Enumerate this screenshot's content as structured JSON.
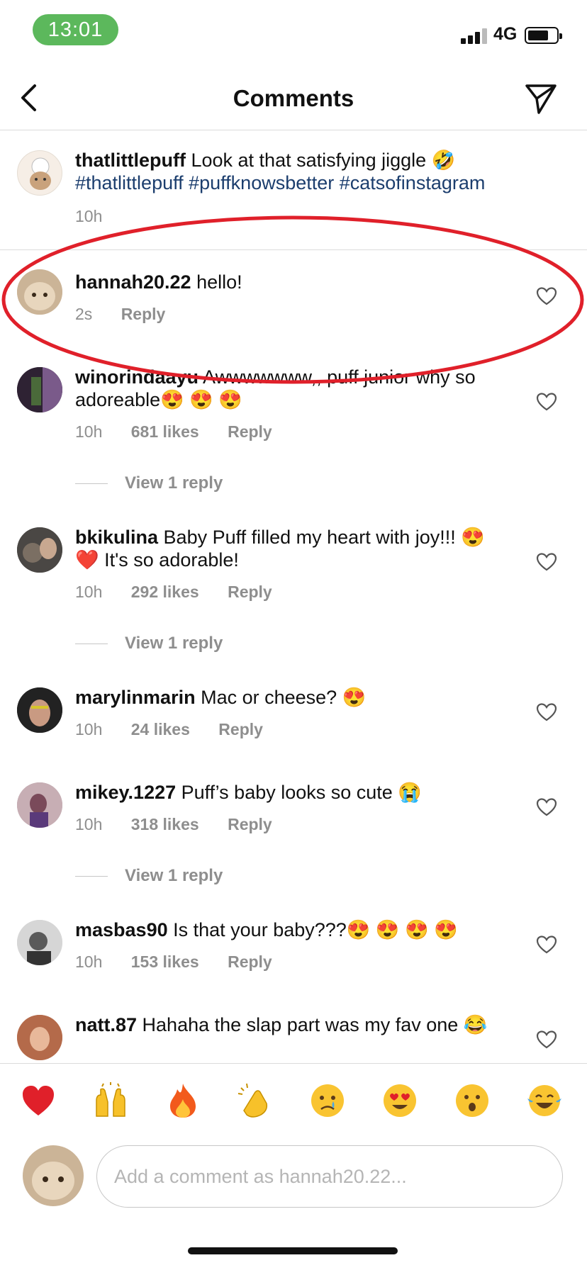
{
  "status_bar": {
    "time": "13:01",
    "network": "4G",
    "time_pill_color": "#5cb85c"
  },
  "header": {
    "title": "Comments",
    "back_icon": "chevron-left-icon",
    "send_icon": "paper-plane-icon"
  },
  "caption": {
    "username": "thatlittlepuff",
    "text": "Look at that satisfying jiggle 🤣",
    "hashtags": "#thatlittlepuff #puffknowsbetter #catsofinstagram",
    "timestamp": "10h"
  },
  "comments": [
    {
      "username": "hannah20.22",
      "text": "hello!",
      "timestamp": "2s",
      "likes": "",
      "reply": "Reply",
      "view_replies": ""
    },
    {
      "username": "winorindaayu",
      "text": "Awwwwwww,, puff junior why so adoreable😍 😍 😍",
      "timestamp": "10h",
      "likes": "681 likes",
      "reply": "Reply",
      "view_replies": "View 1 reply"
    },
    {
      "username": "bkikulina",
      "text": "Baby Puff filled my heart with joy!!! 😍 ❤️ It's so adorable!",
      "timestamp": "10h",
      "likes": "292 likes",
      "reply": "Reply",
      "view_replies": "View 1 reply"
    },
    {
      "username": "marylinmarin",
      "text": "Mac or cheese? 😍",
      "timestamp": "10h",
      "likes": "24 likes",
      "reply": "Reply",
      "view_replies": ""
    },
    {
      "username": "mikey.1227",
      "text": "Puff’s baby looks so cute 😭",
      "timestamp": "10h",
      "likes": "318 likes",
      "reply": "Reply",
      "view_replies": "View 1 reply"
    },
    {
      "username": "masbas90",
      "text": "Is that your baby???😍 😍 😍 😍",
      "timestamp": "10h",
      "likes": "153 likes",
      "reply": "Reply",
      "view_replies": ""
    },
    {
      "username": "natt.87",
      "text": "Hahaha the slap part was my fav one 😂",
      "timestamp": "",
      "likes": "",
      "reply": "",
      "view_replies": ""
    }
  ],
  "quick_reactions": [
    "❤️",
    "🙌",
    "🔥",
    "👏",
    "😢",
    "😍",
    "😮",
    "😂"
  ],
  "composer": {
    "placeholder": "Add a comment as hannah20.22..."
  },
  "accent_colors": {
    "hashtag": "#1c3e6e",
    "highlight_ring": "#e0202a",
    "muted_text": "#8e8e8e"
  }
}
